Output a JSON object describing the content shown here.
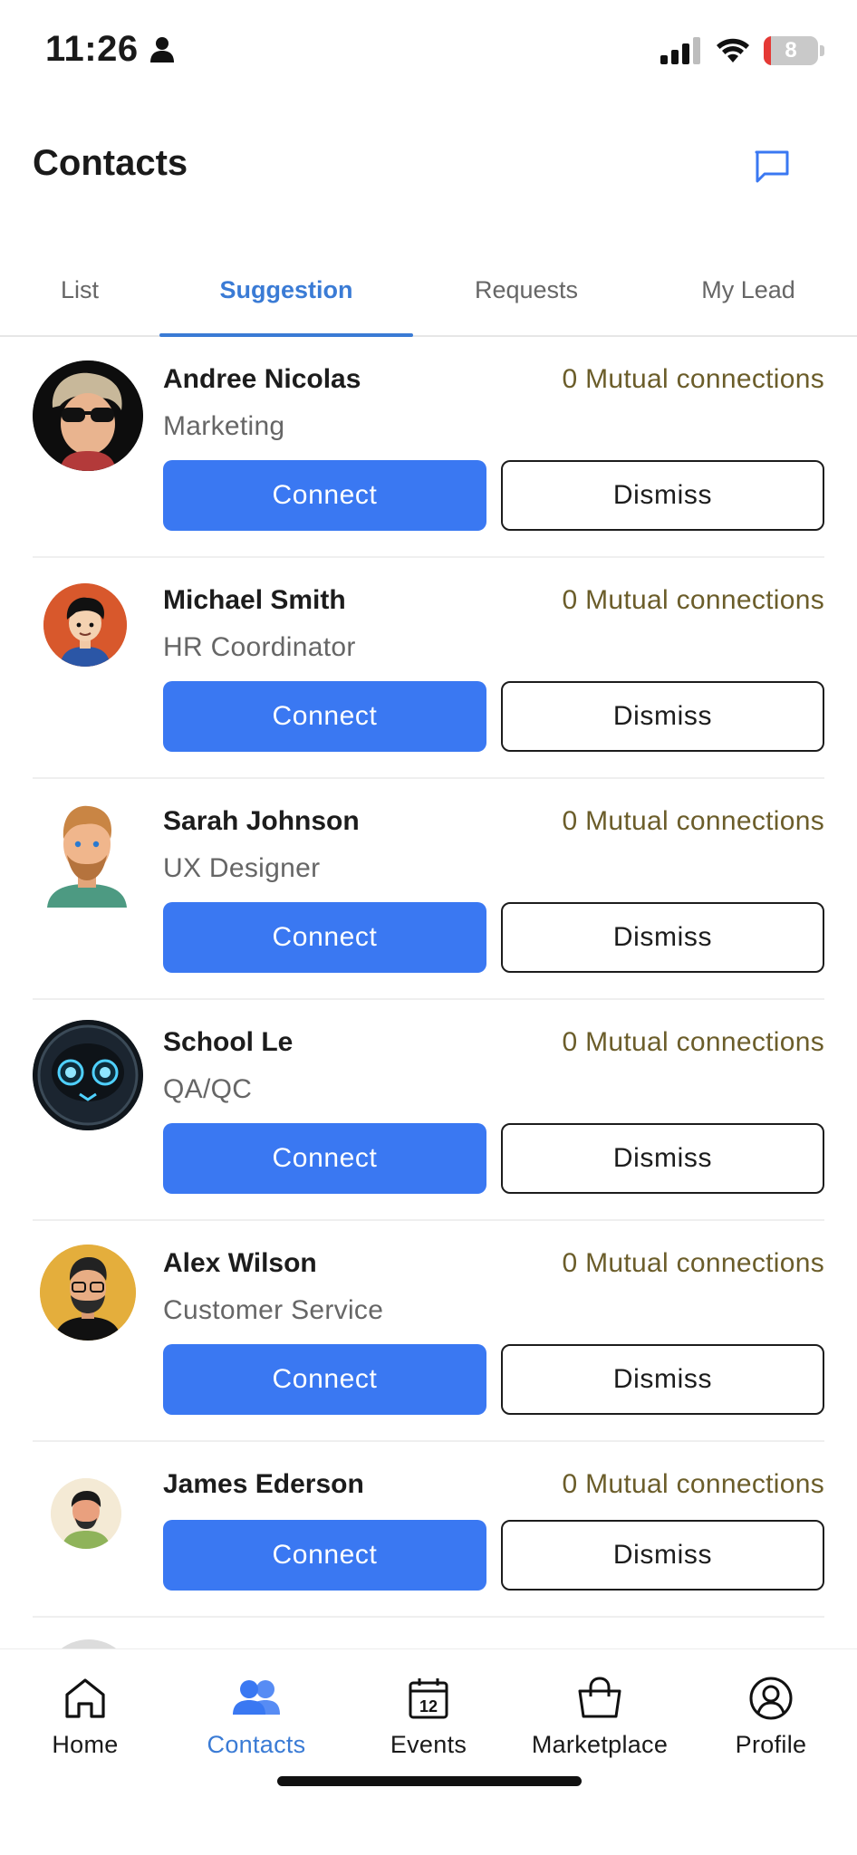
{
  "status_bar": {
    "time": "11:26",
    "battery": "8"
  },
  "header": {
    "title": "Contacts"
  },
  "tabs": [
    {
      "label": "List",
      "active": false
    },
    {
      "label": "Suggestion",
      "active": true
    },
    {
      "label": "Requests",
      "active": false
    },
    {
      "label": "My Lead",
      "active": false
    }
  ],
  "suggestions": [
    {
      "name": "Andree Nicolas",
      "role": "Marketing",
      "mutual": "0 Mutual connections",
      "connect": "Connect",
      "dismiss": "Dismiss"
    },
    {
      "name": "Michael Smith",
      "role": "HR Coordinator",
      "mutual": "0 Mutual connections",
      "connect": "Connect",
      "dismiss": "Dismiss"
    },
    {
      "name": "Sarah Johnson",
      "role": "UX Designer",
      "mutual": "0 Mutual connections",
      "connect": "Connect",
      "dismiss": "Dismiss"
    },
    {
      "name": "School Le",
      "role": "QA/QC",
      "mutual": "0 Mutual connections",
      "connect": "Connect",
      "dismiss": "Dismiss"
    },
    {
      "name": "Alex Wilson",
      "role": "Customer Service",
      "mutual": "0 Mutual connections",
      "connect": "Connect",
      "dismiss": "Dismiss"
    },
    {
      "name": "James Ederson",
      "role": "",
      "mutual": "0 Mutual connections",
      "connect": "Connect",
      "dismiss": "Dismiss"
    }
  ],
  "bottom_nav": [
    {
      "label": "Home",
      "icon": "home-icon",
      "active": false
    },
    {
      "label": "Contacts",
      "icon": "contacts-icon",
      "active": true
    },
    {
      "label": "Events",
      "icon": "calendar-icon",
      "active": false,
      "badge": "12"
    },
    {
      "label": "Marketplace",
      "icon": "shopping-bag-icon",
      "active": false
    },
    {
      "label": "Profile",
      "icon": "profile-icon",
      "active": false
    }
  ],
  "colors": {
    "accent": "#3a78f2",
    "tab_active": "#3a7bd5",
    "mutual_text": "#6b5d2a"
  }
}
